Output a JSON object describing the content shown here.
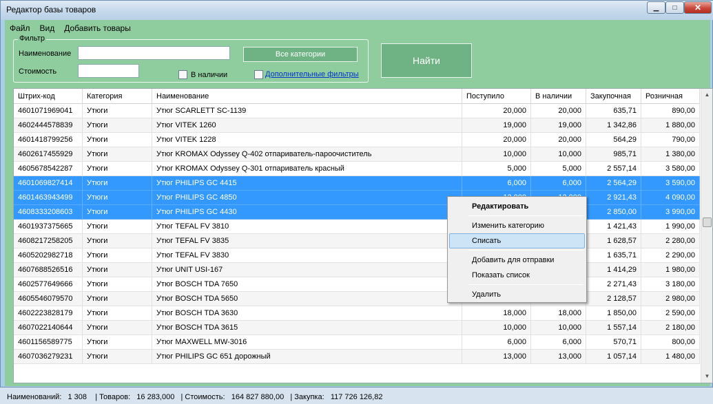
{
  "window": {
    "title": "Редактор базы товаров"
  },
  "menu": [
    "Файл",
    "Вид",
    "Добавить товары"
  ],
  "filter": {
    "legend": "Фильтр",
    "name_label": "Наименование",
    "name_value": "",
    "cost_label": "Стоимость",
    "cost_value": "",
    "all_categories_button": "Все категории",
    "in_stock_label": "В наличии",
    "more_filters_label": "Дополнительные фильтры"
  },
  "find_button": "Найти",
  "grid": {
    "columns": [
      "Штрих-код",
      "Категория",
      "Наименование",
      "Поступило",
      "В наличии",
      "Закупочная",
      "Розничная"
    ],
    "rows": [
      [
        "4601071969041",
        "Утюги",
        "Утюг SCARLETT SC-1139",
        "20,000",
        "20,000",
        "635,71",
        "890,00"
      ],
      [
        "4602444578839",
        "Утюги",
        "Утюг VITEK 1260",
        "19,000",
        "19,000",
        "1 342,86",
        "1 880,00"
      ],
      [
        "4601418799256",
        "Утюги",
        "Утюг VITEK 1228",
        "20,000",
        "20,000",
        "564,29",
        "790,00"
      ],
      [
        "4602617455929",
        "Утюги",
        "Утюг KROMAX Odyssey Q-402  отпариватель-пароочиститель",
        "10,000",
        "10,000",
        "985,71",
        "1 380,00"
      ],
      [
        "4605678542287",
        "Утюги",
        "Утюг KROMAX Odyssey Q-301 отпариватель красный",
        "5,000",
        "5,000",
        "2 557,14",
        "3 580,00"
      ],
      [
        "4601069827414",
        "Утюги",
        "Утюг PHILIPS GC 4415",
        "6,000",
        "6,000",
        "2 564,29",
        "3 590,00"
      ],
      [
        "4601463943499",
        "Утюги",
        "Утюг PHILIPS GC 4850",
        "12,000",
        "12,000",
        "2 921,43",
        "4 090,00"
      ],
      [
        "4608333208603",
        "Утюги",
        "Утюг PHILIPS GC 4430",
        "",
        "",
        "2 850,00",
        "3 990,00"
      ],
      [
        "4601937375665",
        "Утюги",
        "Утюг TEFAL FV 3810",
        "",
        "",
        "1 421,43",
        "1 990,00"
      ],
      [
        "4608217258205",
        "Утюги",
        "Утюг TEFAL FV 3835",
        "",
        "",
        "1 628,57",
        "2 280,00"
      ],
      [
        "4605202982718",
        "Утюги",
        "Утюг TEFAL FV 3830",
        "",
        "",
        "1 635,71",
        "2 290,00"
      ],
      [
        "4607688526516",
        "Утюги",
        "Утюг UNIT USI-167",
        "",
        "",
        "1 414,29",
        "1 980,00"
      ],
      [
        "4602577649666",
        "Утюги",
        "Утюг BOSCH TDA 7650",
        "",
        "",
        "2 271,43",
        "3 180,00"
      ],
      [
        "4605546079570",
        "Утюги",
        "Утюг BOSCH TDA 5650",
        "",
        "",
        "2 128,57",
        "2 980,00"
      ],
      [
        "4602223828179",
        "Утюги",
        "Утюг BOSCH TDA 3630",
        "18,000",
        "18,000",
        "1 850,00",
        "2 590,00"
      ],
      [
        "4607022140644",
        "Утюги",
        "Утюг BOSCH TDA 3615",
        "10,000",
        "10,000",
        "1 557,14",
        "2 180,00"
      ],
      [
        "4601156589775",
        "Утюги",
        "Утюг MAXWELL MW-3016",
        "6,000",
        "6,000",
        "570,71",
        "800,00"
      ],
      [
        "4607036279231",
        "Утюги",
        "Утюг PHILIPS GC 651 дорожный",
        "13,000",
        "13,000",
        "1 057,14",
        "1 480,00"
      ]
    ],
    "selected_rows": [
      5,
      6,
      7
    ]
  },
  "context_menu": {
    "items": [
      "Редактировать",
      "Изменить категорию",
      "Списать",
      "Добавить для отправки",
      "Показать список",
      "Удалить"
    ],
    "highlighted": "Списать"
  },
  "status": {
    "text": "Наименований:   1 308    | Товаров:   16 283,000   | Стоимость:   164 827 880,00   | Закупка:   117 726 126,82"
  }
}
